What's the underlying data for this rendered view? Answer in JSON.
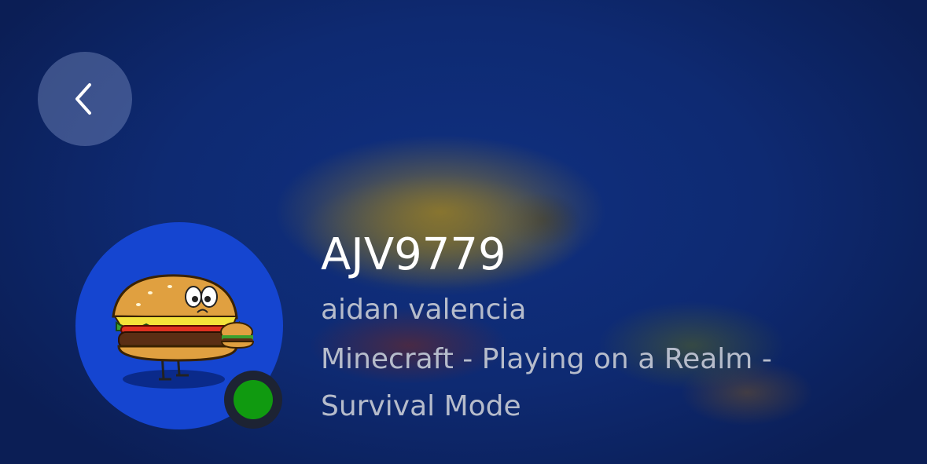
{
  "profile": {
    "gamertag": "AJV9779",
    "real_name": "aidan valencia",
    "activity": "Minecraft - Playing on a Realm - Survival Mode",
    "presence": "online"
  },
  "icons": {
    "back": "chevron-left-icon",
    "avatar": "hamburger-character-avatar",
    "presence": "online-status-dot"
  },
  "colors": {
    "background": "#0d2466",
    "presence_online": "#109a10",
    "avatar_bg": "#1545d0",
    "primary_text": "#ffffff",
    "secondary_text": "#b6bccb"
  }
}
